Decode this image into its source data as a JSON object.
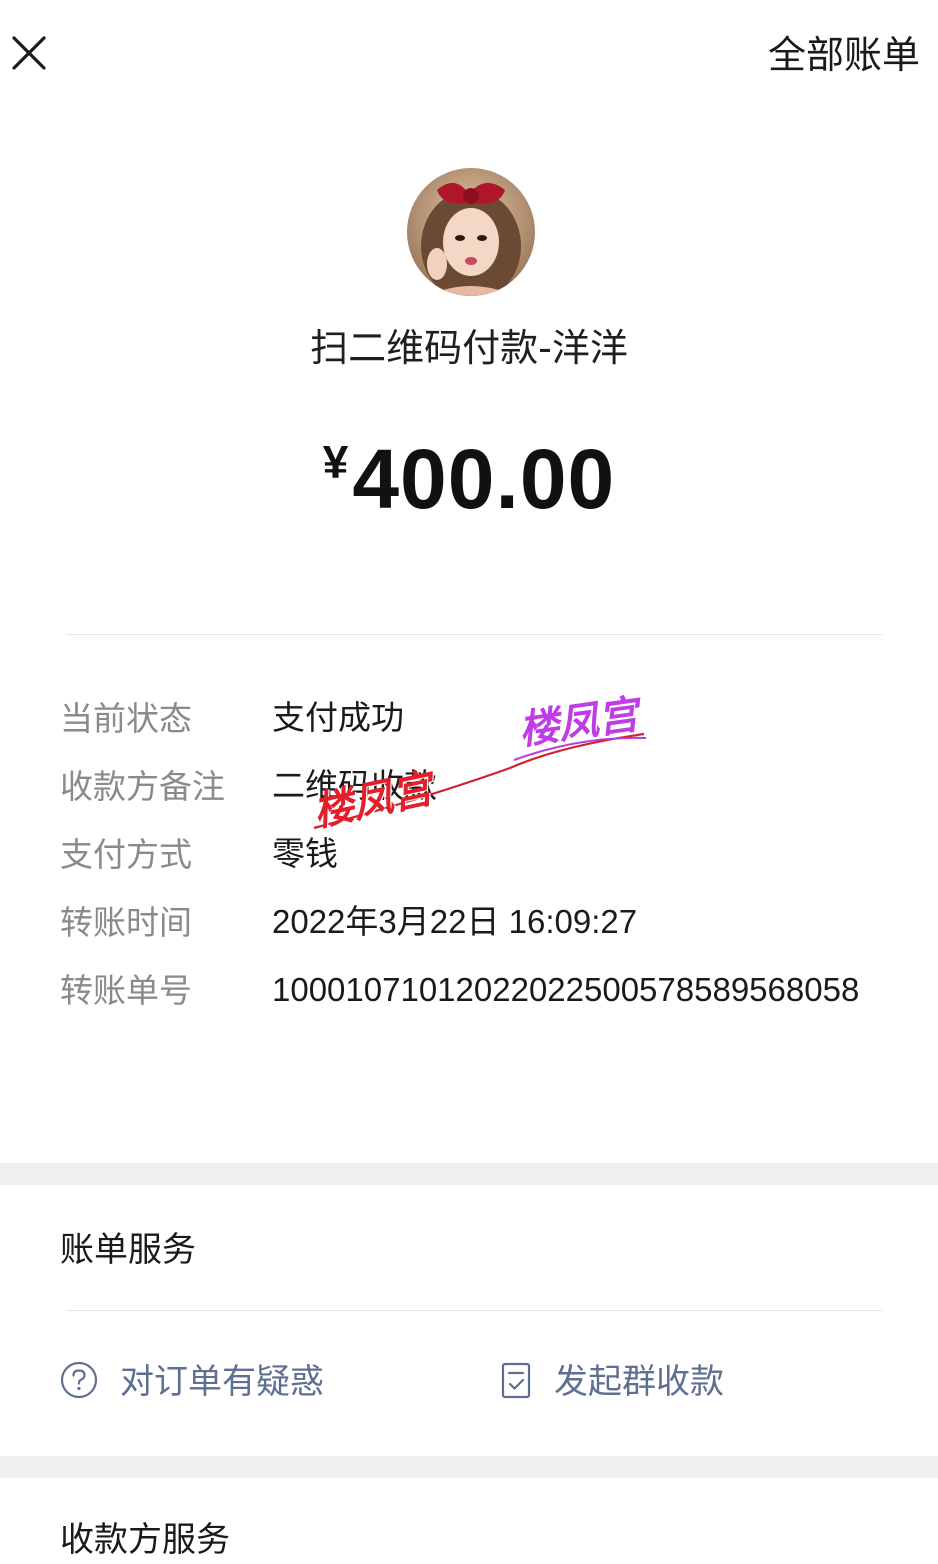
{
  "header": {
    "close_icon": "close-icon",
    "all_bills": "全部账单"
  },
  "payment": {
    "avatar": "avatar",
    "title": "扫二维码付款-洋洋",
    "currency": "¥",
    "amount": "400.00"
  },
  "details": [
    {
      "label": "当前状态",
      "value": "支付成功"
    },
    {
      "label": "收款方备注",
      "value": "二维码收款"
    },
    {
      "label": "支付方式",
      "value": "零钱"
    },
    {
      "label": "转账时间",
      "value": "2022年3月22日 16:09:27"
    },
    {
      "label": "转账单号",
      "value": "10001071012022022500578589568058"
    }
  ],
  "watermark": {
    "text1": "楼凤宫",
    "text2": "楼凤宫"
  },
  "bill_service": {
    "title": "账单服务",
    "question_icon": "question-circle-icon",
    "question_label": "对订单有疑惑",
    "group_icon": "document-check-icon",
    "group_label": "发起群收款"
  },
  "payee_service": {
    "title": "收款方服务"
  },
  "colors": {
    "label_gray": "#8a8a8a",
    "link_blue": "#5f6f93",
    "section_gap": "#efefef"
  }
}
